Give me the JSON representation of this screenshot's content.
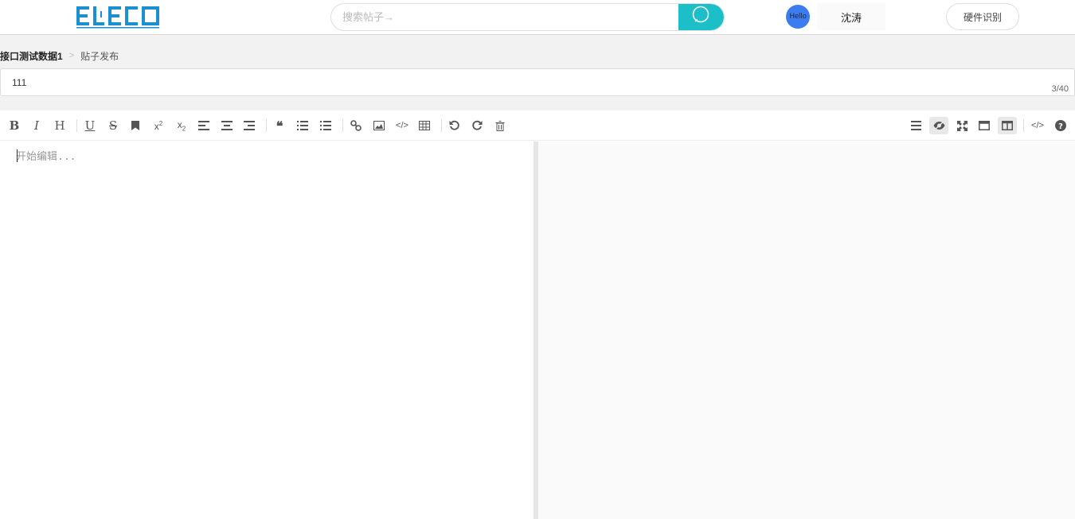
{
  "header": {
    "logo_text": "ELECO",
    "search_placeholder": "搜索帖子→",
    "avatar_text": "Hello",
    "username": "沈涛",
    "hardware_button": "硬件识别"
  },
  "breadcrumb": {
    "current": "接口测试数据1",
    "separator": ">",
    "item": "贴子发布"
  },
  "title_field": {
    "value": "111",
    "counter": "3/40"
  },
  "editor": {
    "placeholder": "开始编辑..."
  },
  "colors": {
    "accent": "#1cbfc8",
    "logo": "#1b8fd0",
    "avatar": "#3b7cf0"
  }
}
